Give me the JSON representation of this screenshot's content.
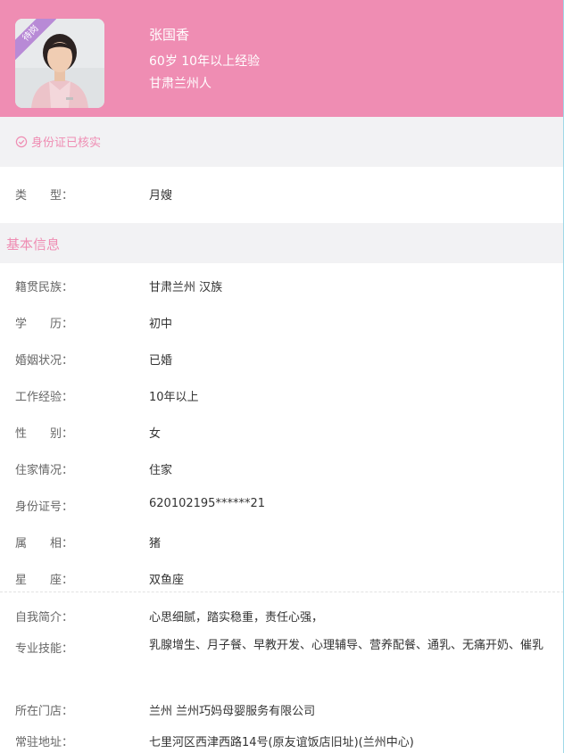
{
  "colors": {
    "accent": "#ef8db3",
    "badge": "#b88ad6",
    "panel": "#f2f2f4"
  },
  "profile": {
    "badge": "待岗",
    "name": "张国香",
    "meta": "60岁 10年以上经验",
    "origin": "甘肃兰州人"
  },
  "verified": {
    "icon": "check-circle-icon",
    "text": "身份证已核实"
  },
  "type_row": {
    "label": "类　　型：",
    "value": "月嫂"
  },
  "section": {
    "title": "基本信息"
  },
  "basic_info": [
    {
      "label": "籍贯民族：",
      "value": "甘肃兰州 汉族"
    },
    {
      "label": "学　　历：",
      "value": "初中"
    },
    {
      "label": "婚姻状况：",
      "value": "已婚"
    },
    {
      "label": "工作经验：",
      "value": "10年以上"
    },
    {
      "label": "性　　别：",
      "value": "女"
    },
    {
      "label": "住家情况：",
      "value": "住家"
    },
    {
      "label": "身份证号：",
      "value": "620102195******21"
    },
    {
      "label": "属　　相：",
      "value": "猪"
    },
    {
      "label": "星　　座：",
      "value": "双鱼座"
    }
  ],
  "extra_info": [
    {
      "label": "自我简介：",
      "value": "心思细腻，踏实稳重，责任心强，"
    },
    {
      "label": "专业技能：",
      "value": "乳腺增生、月子餐、早教开发、心理辅导、营养配餐、通乳、无痛开奶、催乳"
    },
    {
      "label": "所在门店：",
      "value": "兰州 兰州巧妈母婴服务有限公司"
    },
    {
      "label": "常驻地址：",
      "value": "七里河区西津西路14号(原友谊饭店旧址)(兰州中心)"
    }
  ]
}
